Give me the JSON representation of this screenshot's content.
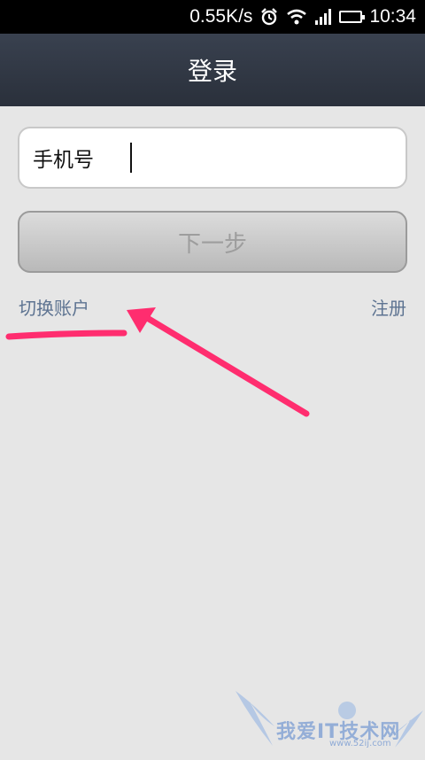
{
  "status_bar": {
    "network_speed": "0.55K/s",
    "time": "10:34",
    "icons": [
      "alarm-icon",
      "wifi-icon",
      "signal-icon",
      "battery-icon"
    ],
    "battery_color": "#5ed62b"
  },
  "header": {
    "title": "登录"
  },
  "form": {
    "phone_label": "手机号",
    "phone_value": "",
    "next_label": "下一步"
  },
  "links": {
    "switch_account": "切换账户",
    "register": "注册"
  },
  "annotation": {
    "color": "#ff2d6f"
  },
  "watermark": {
    "text": "我爱IT技术网",
    "url": "www.52ij.com"
  }
}
